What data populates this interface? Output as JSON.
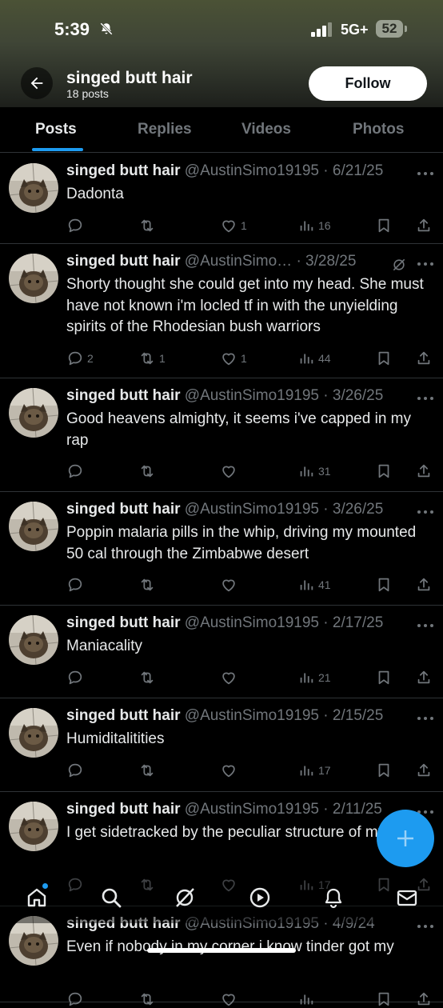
{
  "status_bar": {
    "time": "5:39",
    "network": "5G+",
    "battery": "52"
  },
  "header": {
    "title": "singed butt hair",
    "post_count": "18 posts",
    "follow_label": "Follow"
  },
  "tabs": [
    "Posts",
    "Replies",
    "Videos",
    "Photos"
  ],
  "active_tab": "Posts",
  "posts": [
    {
      "author": "singed butt hair",
      "meta": "@AustinSimo19195 · 6/21/25",
      "text": "Dadonta",
      "replies": "",
      "reposts": "",
      "likes": "1",
      "views": "16"
    },
    {
      "author": "singed butt hair",
      "meta": "@AustinSimo… · 3/28/25",
      "text": "Shorty thought she could get into my head. She must have not known i'm locled tf in with the unyielding spirits of the Rhodesian bush warriors",
      "replies": "2",
      "reposts": "1",
      "likes": "1",
      "views": "44",
      "has_grok": true
    },
    {
      "author": "singed butt hair",
      "meta": "@AustinSimo19195 · 3/26/25",
      "text": "Good heavens almighty, it seems i've capped in my rap",
      "replies": "",
      "reposts": "",
      "likes": "",
      "views": "31"
    },
    {
      "author": "singed butt hair",
      "meta": "@AustinSimo19195 · 3/26/25",
      "text": "Poppin malaria pills in the whip, driving my mounted 50 cal through the Zimbabwe desert",
      "replies": "",
      "reposts": "",
      "likes": "",
      "views": "41"
    },
    {
      "author": "singed butt hair",
      "meta": "@AustinSimo19195 · 2/17/25",
      "text": "Maniacality",
      "replies": "",
      "reposts": "",
      "likes": "",
      "views": "21"
    },
    {
      "author": "singed butt hair",
      "meta": "@AustinSimo19195 · 2/15/25",
      "text": "Humiditalitities",
      "replies": "",
      "reposts": "",
      "likes": "",
      "views": "17"
    },
    {
      "author": "singed butt hair",
      "meta": "@AustinSimo19195 · 2/11/25",
      "text": "I get sidetracked by the peculiar structure of my neck",
      "replies": "",
      "reposts": "",
      "likes": "",
      "views": "17"
    },
    {
      "author": "singed butt hair",
      "meta": "@AustinSimo19195 · 4/9/24",
      "text": "Even if nobody in my corner i know tinder got my",
      "replies": "",
      "reposts": "",
      "likes": "",
      "views": ""
    }
  ],
  "bottom_nav": [
    "home-icon",
    "search-icon",
    "grok-icon",
    "video-icon",
    "notifications-icon",
    "messages-icon"
  ],
  "colors": {
    "accent": "#1d9bf0",
    "background": "#000000",
    "text": "#e7e9ea",
    "muted": "#71767b",
    "divider": "#2f3336"
  }
}
